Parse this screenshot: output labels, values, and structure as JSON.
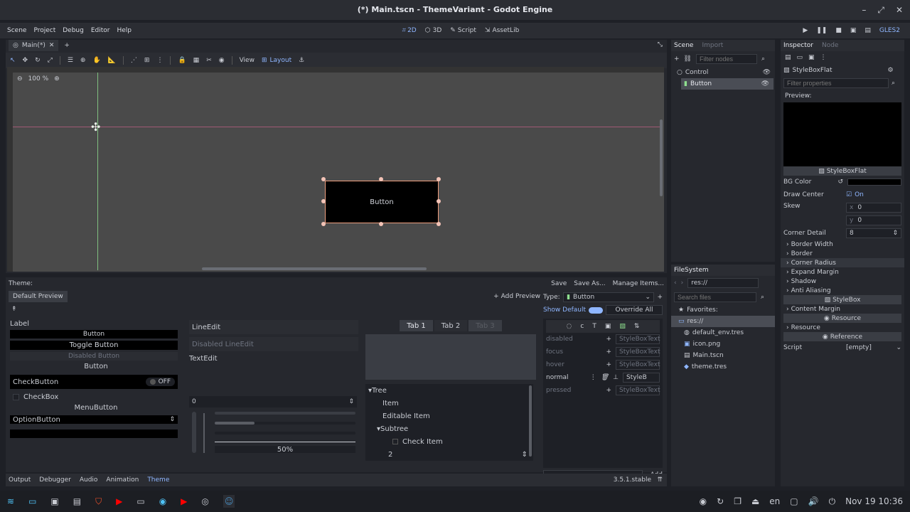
{
  "window": {
    "title": "(*) Main.tscn - ThemeVariant - Godot Engine"
  },
  "menu": [
    "Scene",
    "Project",
    "Debug",
    "Editor",
    "Help"
  ],
  "workspaces": [
    {
      "label": "2D",
      "active": true
    },
    {
      "label": "3D"
    },
    {
      "label": "Script"
    },
    {
      "label": "AssetLib"
    }
  ],
  "renderer": "GLES2",
  "editor": {
    "tab": "Main(*)",
    "zoom": "100 %",
    "view_label": "View",
    "layout_label": "Layout",
    "button_text": "Button"
  },
  "scene": {
    "tab": "Scene",
    "tab2": "Import",
    "filter_placeholder": "Filter nodes",
    "nodes": [
      "Control",
      "Button"
    ]
  },
  "filesystem": {
    "title": "FileSystem",
    "path": "res://",
    "search_placeholder": "Search files",
    "favorites": "Favorites:",
    "root": "res://",
    "files": [
      "default_env.tres",
      "icon.png",
      "Main.tscn",
      "theme.tres"
    ]
  },
  "inspector": {
    "tab": "Inspector",
    "tab2": "Node",
    "resource": "StyleBoxFlat",
    "filter_placeholder": "Filter properties",
    "preview": "Preview:",
    "preview_label": "StyleBoxFlat",
    "bg_color": "BG Color",
    "draw_center": "Draw Center",
    "draw_center_val": "On",
    "skew": "Skew",
    "skew_x": "x",
    "skew_x_val": "0",
    "skew_y": "y",
    "skew_y_val": "0",
    "corner_detail": "Corner Detail",
    "corner_detail_val": "8",
    "subsections": [
      "Border Width",
      "Border",
      "Corner Radius",
      "Expand Margin",
      "Shadow",
      "Anti Aliasing"
    ],
    "sec_stylebox": "StyleBox",
    "content_margin": "Content Margin",
    "sec_resource": "Resource",
    "resource_sub": "Resource",
    "sec_reference": "Reference",
    "script": "Script",
    "script_val": "[empty]"
  },
  "theme": {
    "label": "Theme:",
    "save": "Save",
    "save_as": "Save As...",
    "manage": "Manage Items...",
    "default_preview": "Default Preview",
    "add_preview": "Add Preview",
    "type_label": "Type:",
    "type_value": "Button",
    "show_default": "Show Default",
    "override_all": "Override All",
    "add": "Add",
    "items": [
      {
        "name": "disabled",
        "value": "StyleBoxText"
      },
      {
        "name": "focus",
        "value": "StyleBoxText"
      },
      {
        "name": "hover",
        "value": "StyleBoxText"
      },
      {
        "name": "normal",
        "value": "StyleB"
      },
      {
        "name": "pressed",
        "value": "StyleBoxText"
      }
    ]
  },
  "preview": {
    "label": "Label",
    "button": "Button",
    "toggle": "Toggle Button",
    "disabled": "Disabled Button",
    "button2": "Button",
    "checkbutton": "CheckButton",
    "off": "OFF",
    "checkbox": "CheckBox",
    "menubutton": "MenuButton",
    "optionbutton": "OptionButton",
    "lineedit": "LineEdit",
    "disabled_lineedit": "Disabled LineEdit",
    "textedit": "TextEdit",
    "spin": "0",
    "progress": "50%",
    "tabs": [
      "Tab 1",
      "Tab 2",
      "Tab 3"
    ],
    "tree": [
      "Tree",
      "Item",
      "Editable Item",
      "Subtree",
      "Check Item",
      "2"
    ]
  },
  "bottom_tabs": [
    "Output",
    "Debugger",
    "Audio",
    "Animation",
    "Theme"
  ],
  "version": "3.5.1.stable",
  "taskbar": {
    "lang": "en",
    "datetime": "Nov 19  10:36"
  }
}
